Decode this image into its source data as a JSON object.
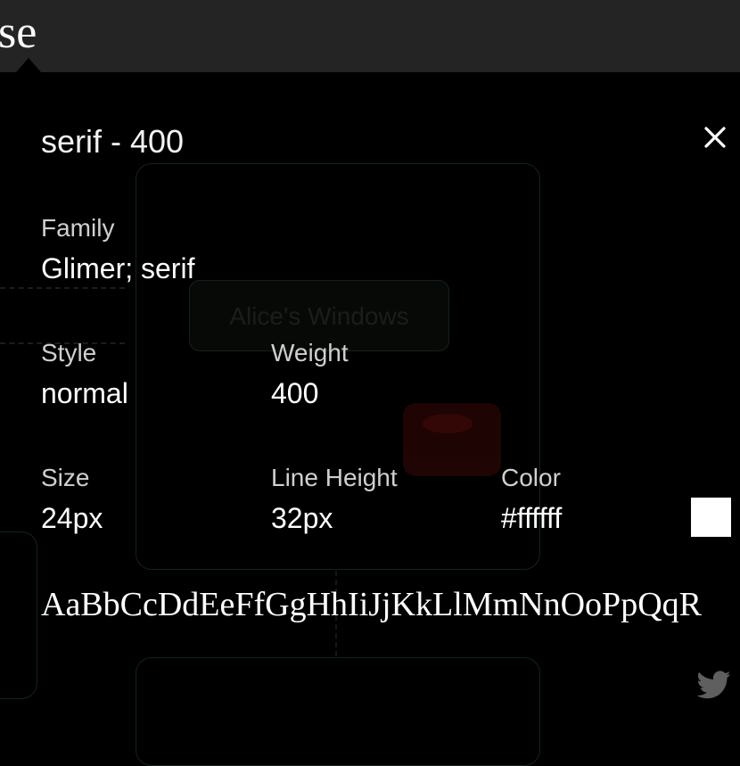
{
  "topbar": {
    "partial_title": "se"
  },
  "background": {
    "button_label": "Alice's Windows"
  },
  "popup": {
    "title": "serif - 400",
    "family_label": "Family",
    "family_value": "Glimer; serif",
    "style_label": "Style",
    "style_value": "normal",
    "weight_label": "Weight",
    "weight_value": "400",
    "size_label": "Size",
    "size_value": "24px",
    "line_height_label": "Line Height",
    "line_height_value": "32px",
    "color_label": "Color",
    "color_value": "#ffffff",
    "sample": "AaBbCcDdEeFfGgHhIiJjKkLlMmNnOoPpQqR"
  },
  "icons": {
    "close": "close-icon",
    "share": "twitter-icon"
  },
  "colors": {
    "background": "#000000",
    "topbar": "#242424",
    "swatch": "#ffffff"
  }
}
